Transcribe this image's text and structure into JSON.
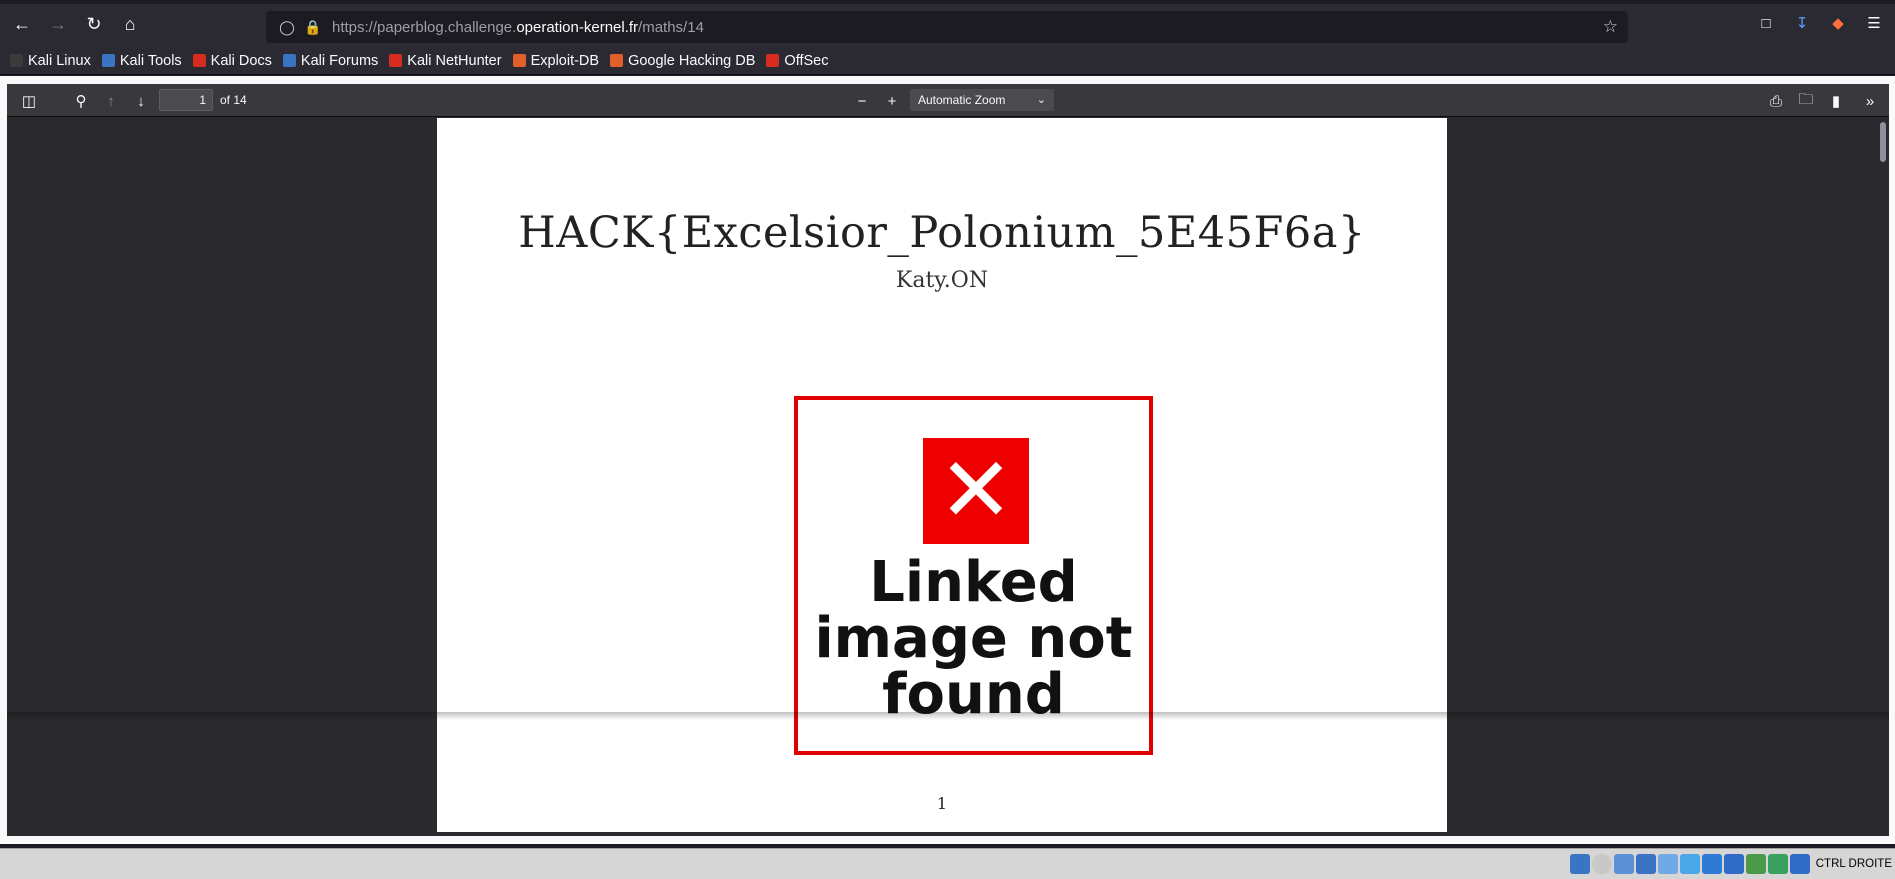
{
  "browser": {
    "url_prefix": "https://paperblog.challenge.",
    "url_domain": "operation-kernel.fr",
    "url_path": "/maths/14"
  },
  "bookmarks": [
    {
      "label": "Kali Linux",
      "color": "#3b3b3b"
    },
    {
      "label": "Kali Tools",
      "color": "#3a74c4"
    },
    {
      "label": "Kali Docs",
      "color": "#d62d20"
    },
    {
      "label": "Kali Forums",
      "color": "#3a74c4"
    },
    {
      "label": "Kali NetHunter",
      "color": "#d62d20"
    },
    {
      "label": "Exploit-DB",
      "color": "#e0602c"
    },
    {
      "label": "Google Hacking DB",
      "color": "#e0602c"
    },
    {
      "label": "OffSec",
      "color": "#d62d20"
    }
  ],
  "pdf_toolbar": {
    "page_value": "1",
    "page_count": "of 14",
    "zoom": "Automatic Zoom"
  },
  "document": {
    "title": "HACK{Excelsior_Polonium_5E45F6a}",
    "author": "Katy.ON",
    "broken_image_text": "Linked image not found",
    "page_number": "1"
  },
  "taskbar": {
    "keyboard_label": "CTRL DROITE"
  }
}
